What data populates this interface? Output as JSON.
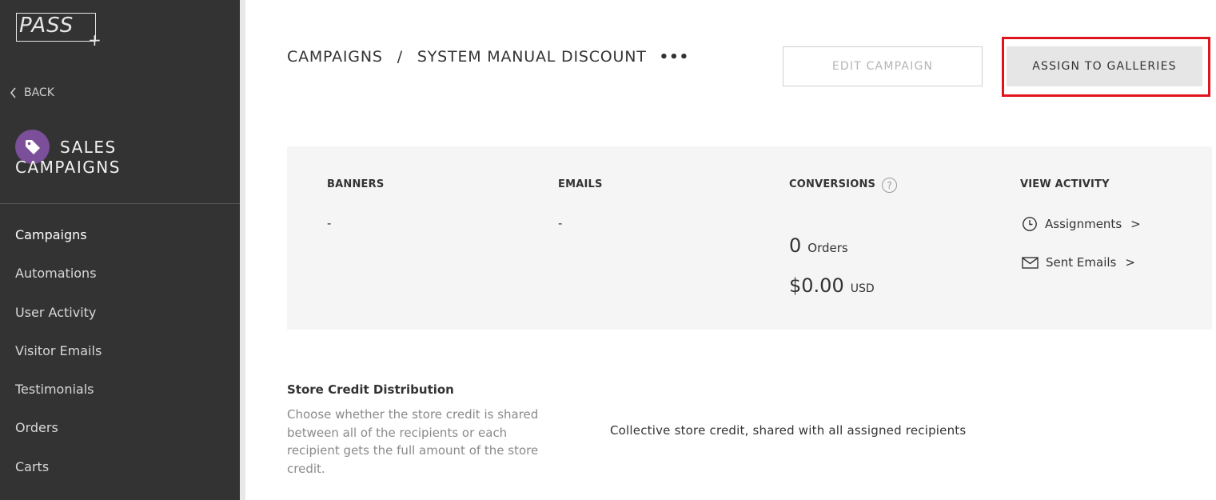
{
  "logo": {
    "text": "PASS",
    "plus": "+"
  },
  "sidebar": {
    "back_label": "BACK",
    "section_title_line1": "SALES",
    "section_title_line2": "CAMPAIGNS",
    "accent_color": "#7b4f99",
    "items": [
      {
        "label": "Campaigns",
        "active": true
      },
      {
        "label": "Automations"
      },
      {
        "label": "User Activity"
      },
      {
        "label": "Visitor Emails"
      },
      {
        "label": "Testimonials"
      },
      {
        "label": "Orders"
      },
      {
        "label": "Carts"
      }
    ]
  },
  "breadcrumb": {
    "root": "CAMPAIGNS",
    "separator": "/",
    "current": "SYSTEM MANUAL DISCOUNT",
    "more": "•••"
  },
  "toolbar": {
    "edit_label": "EDIT CAMPAIGN",
    "assign_label": "ASSIGN TO GALLERIES",
    "highlight_color": "#e0141c"
  },
  "stats": {
    "banners": {
      "label": "BANNERS",
      "value": "-"
    },
    "emails": {
      "label": "EMAILS",
      "value": "-"
    },
    "conversions": {
      "label": "CONVERSIONS",
      "help": "?",
      "orders_count": "0",
      "orders_unit": "Orders",
      "amount": "$0.00",
      "currency": "USD"
    },
    "activity": {
      "label": "VIEW ACTIVITY",
      "assignments": "Assignments",
      "sent_emails": "Sent Emails",
      "chevron": ">"
    }
  },
  "store_credit": {
    "title": "Store Credit Distribution",
    "description": "Choose whether the store credit is shared between all of the recipients or each recipient gets the full amount of the store credit.",
    "value": "Collective store credit, shared with all assigned recipients"
  }
}
